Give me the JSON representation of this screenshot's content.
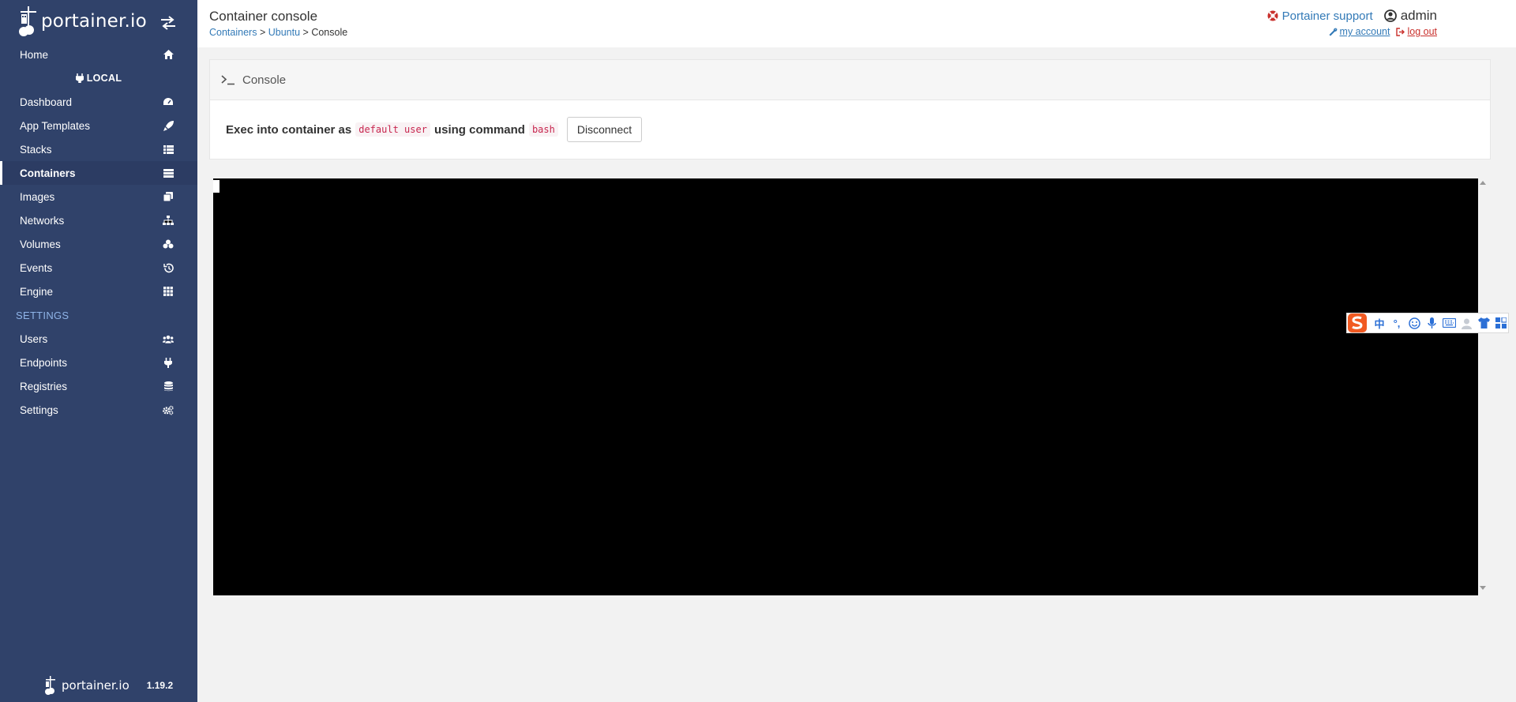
{
  "sidebar": {
    "brand": "portainer.io",
    "items": [
      {
        "label": "Home",
        "icon": "home-icon"
      },
      {
        "label": "Dashboard",
        "icon": "tachometer-icon"
      },
      {
        "label": "App Templates",
        "icon": "rocket-icon"
      },
      {
        "label": "Stacks",
        "icon": "th-list-icon"
      },
      {
        "label": "Containers",
        "icon": "server-icon"
      },
      {
        "label": "Images",
        "icon": "clone-icon"
      },
      {
        "label": "Networks",
        "icon": "sitemap-icon"
      },
      {
        "label": "Volumes",
        "icon": "cubes-icon"
      },
      {
        "label": "Events",
        "icon": "history-icon"
      },
      {
        "label": "Engine",
        "icon": "th-icon"
      }
    ],
    "endpoint_label": "LOCAL",
    "settings_section": "SETTINGS",
    "settings_items": [
      {
        "label": "Users",
        "icon": "users-icon"
      },
      {
        "label": "Endpoints",
        "icon": "plug-icon"
      },
      {
        "label": "Registries",
        "icon": "database-icon"
      },
      {
        "label": "Settings",
        "icon": "cogs-icon"
      }
    ],
    "footer_brand": "portainer.io",
    "version": "1.19.2"
  },
  "header": {
    "title": "Container console",
    "breadcrumb": {
      "containers": "Containers",
      "ubuntu": "Ubuntu",
      "current": "Console",
      "sep": ">"
    },
    "support": "Portainer support",
    "user": "admin",
    "my_account": "my account",
    "log_out": "log out"
  },
  "widget": {
    "title": "Console",
    "exec_prefix": "Exec into container as",
    "user_code": "default user",
    "exec_middle": "using command",
    "command_code": "bash",
    "disconnect_label": "Disconnect"
  },
  "ime": {
    "chinese_char": "中",
    "punct": "°,"
  },
  "colors": {
    "sidebar_bg": "#30426a",
    "link": "#337ab7",
    "danger": "#c9302c",
    "terminal_bg": "#000000"
  }
}
